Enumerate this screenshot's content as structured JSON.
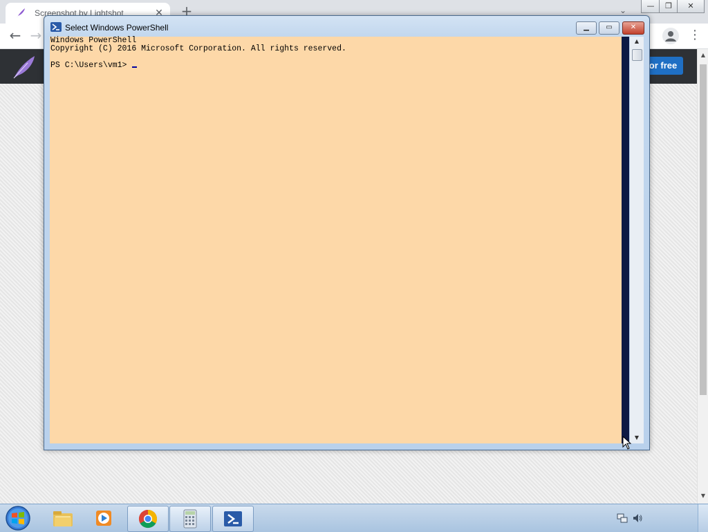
{
  "browser": {
    "tab_title": "Screenshot by Lightshot",
    "tab_close": "✕",
    "new_tab": "+",
    "tab_search": "⌄",
    "back": "←",
    "forward": "→",
    "menu": "⋮",
    "window_controls": {
      "minimize": "—",
      "restore": "❐",
      "close": "✕"
    },
    "site_cta_label": "or free",
    "site_colors": {
      "header": "#2e3135",
      "cta": "#1f6fc4"
    }
  },
  "powershell": {
    "title": "Select Windows PowerShell",
    "controls": {
      "minimize": "▁",
      "maximize": "▭",
      "close": "✕"
    },
    "lines": [
      "Windows PowerShell",
      "Copyright (C) 2016 Microsoft Corporation. All rights reserved.",
      "",
      "PS C:\\Users\\vm1> "
    ],
    "background_color": "#fdd8a8",
    "scroll_up": "▲",
    "scroll_down": "▼"
  },
  "taskbar": {
    "items": [
      {
        "name": "file-explorer-icon",
        "active": false
      },
      {
        "name": "media-player-icon",
        "active": false
      },
      {
        "name": "chrome-icon",
        "active": true
      },
      {
        "name": "calculator-icon",
        "active": true
      },
      {
        "name": "powershell-icon",
        "active": true
      }
    ],
    "tray": [
      "network-icon",
      "volume-icon"
    ]
  },
  "page_scroll": {
    "up": "▲",
    "down": "▼"
  }
}
